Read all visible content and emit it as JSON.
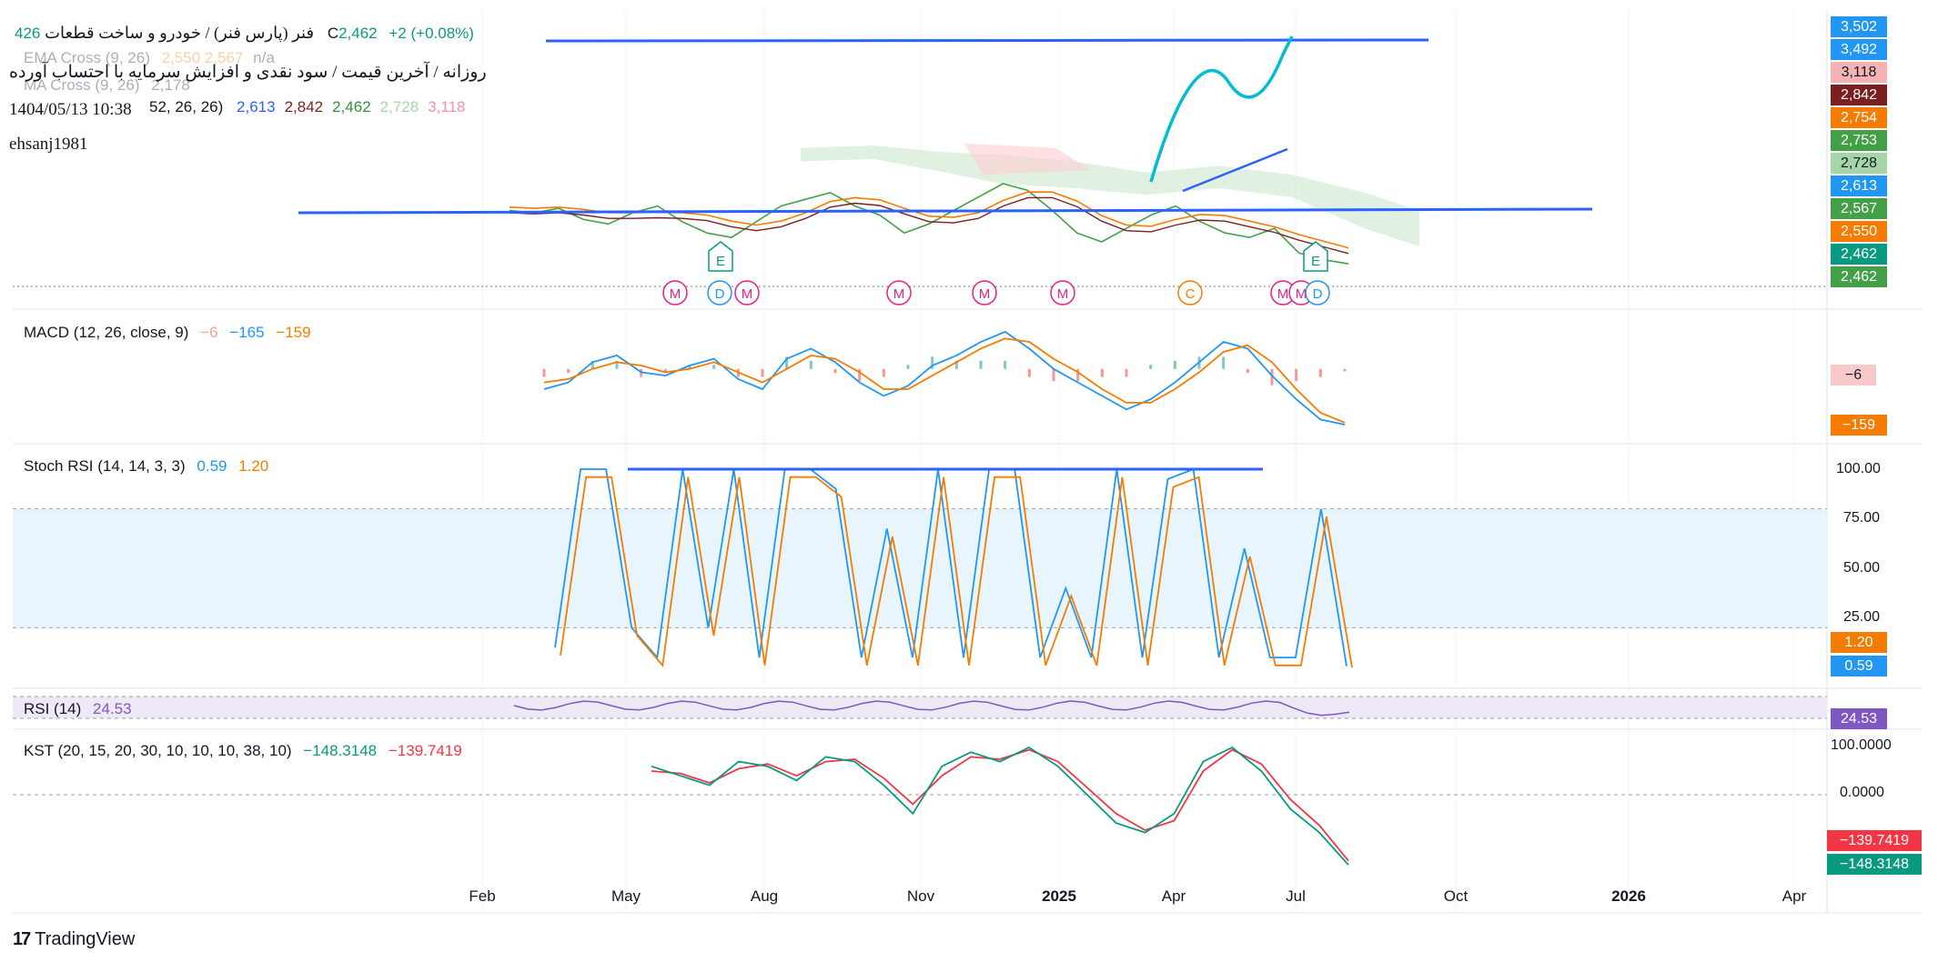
{
  "header": {
    "symbol_line": "فنر (پارس فنر) / خودرو و ساخت قطعات",
    "ohlc_fragment": "426",
    "close_label": "C",
    "close_value": "2,462",
    "change": "+2 (+0.08%)",
    "ema_cross_label": "EMA Cross (9, 26)",
    "ema_cross_values": "2,550  2,567",
    "ema_cross_na": "n/a",
    "ma_cross_label": "MA Cross (9, 26)",
    "ma_cross_value": "2,178",
    "description_line": "روزانه / آخرین قیمت / سود نقدی و افزایش سرمایه با احتساب آورده",
    "ichimoku_params": "52, 26, 26)",
    "ichimoku_values": [
      "2,613",
      "2,842",
      "2,462",
      "2,728",
      "3,118"
    ],
    "ichimoku_colors": [
      "#2962ff",
      "#7f1d1d",
      "#388e3c",
      "#a5d6a7",
      "#f48fb1"
    ],
    "datetime": "1404/05/13 10:38",
    "author": "ehsanj1981"
  },
  "price_scale_labels": [
    {
      "value": "3,502",
      "color": "#2196f3"
    },
    {
      "value": "3,492",
      "color": "#2196f3"
    },
    {
      "value": "3,118",
      "color": "#f5b3b3",
      "text_color": "#131722"
    },
    {
      "value": "2,842",
      "color": "#7b1e1e"
    },
    {
      "value": "2,754",
      "color": "#f57c00"
    },
    {
      "value": "2,753",
      "color": "#43a047"
    },
    {
      "value": "2,728",
      "color": "#a5d6a7",
      "text_color": "#131722"
    },
    {
      "value": "2,613",
      "color": "#2196f3"
    },
    {
      "value": "2,567",
      "color": "#43a047"
    },
    {
      "value": "2,550",
      "color": "#f57c00"
    },
    {
      "value": "2,462",
      "color": "#089981"
    },
    {
      "value": "2,462",
      "color": "#43a047"
    }
  ],
  "event_markers": {
    "earnings": [
      "E",
      "E"
    ],
    "dividends": [
      "D",
      "D"
    ],
    "splits": [
      "C"
    ],
    "meetings": [
      "M",
      "M",
      "M",
      "M",
      "M",
      "M",
      "M"
    ]
  },
  "indicators": {
    "macd": {
      "label": "MACD (12, 26, close, 9)",
      "v1": "−6",
      "v2": "−165",
      "v3": "−159",
      "box_hist": "−6",
      "box_signal": "−159"
    },
    "stoch": {
      "label": "Stoch RSI (14, 14, 3, 3)",
      "k": "0.59",
      "d": "1.20",
      "scale": [
        "100.00",
        "75.00",
        "50.00",
        "25.00"
      ]
    },
    "rsi": {
      "label": "RSI (14)",
      "value": "24.53"
    },
    "kst": {
      "label": "KST (20, 15, 20, 30, 10, 10, 10, 38, 10)",
      "v1": "−148.3148",
      "v2": "−139.7419",
      "scale": [
        "100.0000",
        "0.0000"
      ]
    }
  },
  "x_axis": [
    {
      "label": "Feb",
      "bold": false
    },
    {
      "label": "May",
      "bold": false
    },
    {
      "label": "Aug",
      "bold": false
    },
    {
      "label": "Nov",
      "bold": false
    },
    {
      "label": "2025",
      "bold": true
    },
    {
      "label": "Apr",
      "bold": false
    },
    {
      "label": "Jul",
      "bold": false
    },
    {
      "label": "Oct",
      "bold": false
    },
    {
      "label": "2026",
      "bold": true
    },
    {
      "label": "Apr",
      "bold": false
    }
  ],
  "brand": "TradingView",
  "colors": {
    "ema_fast": "#f57c00",
    "ema_slow": "#43a047",
    "macd": "#2196f3",
    "signal": "#f57c00",
    "rsi": "#7e57c2",
    "kst": "#089981",
    "kst_signal": "#f23645",
    "trendline": "#2962ff",
    "projection": "#00bcd4",
    "cloud_green": "#c8e6c9",
    "cloud_red": "#ffcdd2"
  },
  "chart_data": {
    "type": "line",
    "title": "فنر (پارس فنر) / خودرو و ساخت قطعات",
    "x_labels": [
      "Feb",
      "May",
      "Aug",
      "Nov",
      "2025",
      "Apr",
      "Jul",
      "Oct",
      "2026",
      "Apr"
    ],
    "last_price": 2462,
    "horizontal_levels": [
      3502,
      3492,
      3118,
      2842,
      2754,
      2753,
      2728,
      2613,
      2567,
      2550,
      2462
    ],
    "series": [
      {
        "name": "Close",
        "values": [
          2700,
          2690,
          2710,
          2660,
          2640,
          2690,
          2720,
          2650,
          2600,
          2580,
          2650,
          2720,
          2750,
          2780,
          2720,
          2680,
          2600,
          2640,
          2700,
          2760,
          2820,
          2790,
          2700,
          2600,
          2560,
          2620,
          2680,
          2720,
          2650,
          2600,
          2580,
          2620,
          2510,
          2480,
          2462
        ]
      },
      {
        "name": "MACD",
        "values": [
          -60,
          -40,
          20,
          40,
          -10,
          -20,
          10,
          30,
          -30,
          -60,
          30,
          60,
          20,
          -40,
          -80,
          -50,
          10,
          40,
          80,
          110,
          60,
          0,
          -40,
          -80,
          -120,
          -90,
          -40,
          20,
          80,
          60,
          -20,
          -90,
          -150,
          -165
        ]
      },
      {
        "name": "Signal",
        "values": [
          -40,
          -30,
          0,
          20,
          10,
          -10,
          0,
          20,
          -10,
          -40,
          0,
          40,
          30,
          -10,
          -60,
          -60,
          -20,
          20,
          60,
          90,
          80,
          30,
          -10,
          -60,
          -100,
          -100,
          -60,
          -10,
          50,
          70,
          20,
          -60,
          -130,
          -159
        ]
      },
      {
        "name": "Stoch RSI %K",
        "values": [
          10,
          100,
          100,
          20,
          5,
          100,
          20,
          100,
          5,
          100,
          100,
          90,
          5,
          70,
          5,
          100,
          5,
          100,
          100,
          5,
          40,
          5,
          100,
          5,
          95,
          100,
          5,
          60,
          5,
          5,
          80,
          0.59
        ]
      },
      {
        "name": "KST",
        "values": [
          60,
          40,
          20,
          70,
          60,
          30,
          80,
          70,
          20,
          -40,
          60,
          90,
          70,
          100,
          60,
          0,
          -60,
          -80,
          -40,
          70,
          100,
          50,
          -30,
          -80,
          -148.3148
        ]
      },
      {
        "name": "KST Signal",
        "values": [
          50,
          45,
          25,
          55,
          65,
          40,
          70,
          75,
          35,
          -20,
          40,
          80,
          75,
          95,
          70,
          15,
          -40,
          -75,
          -55,
          50,
          95,
          65,
          -10,
          -65,
          -139.7419
        ]
      }
    ],
    "macd_values": {
      "hist": -6,
      "macd": -165,
      "signal": -159
    },
    "stoch_rsi": {
      "k": 0.59,
      "d": 1.2,
      "ylim": [
        0,
        100
      ],
      "bands": [
        20,
        80
      ]
    },
    "rsi": {
      "value": 24.53
    },
    "kst": {
      "kst": -148.3148,
      "signal": -139.7419,
      "ylim": [
        -150,
        100
      ]
    },
    "grid": true
  }
}
